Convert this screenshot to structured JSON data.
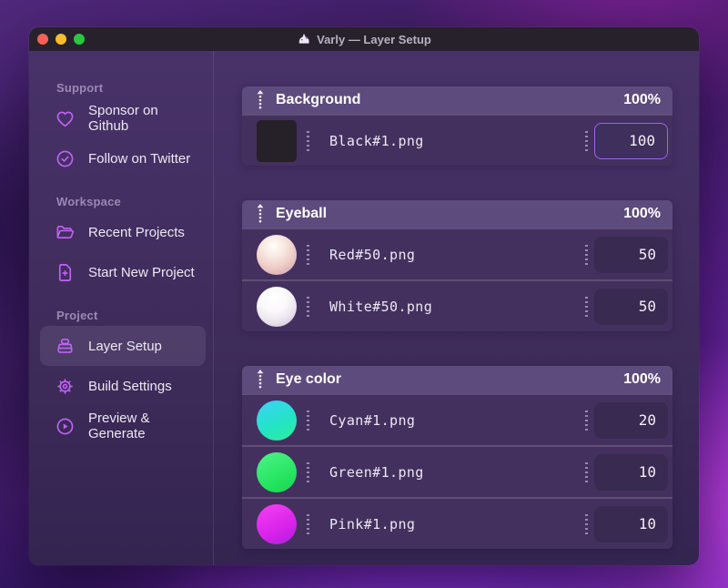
{
  "window": {
    "title": "Varly — Layer Setup"
  },
  "sidebar": {
    "sections": [
      {
        "label": "Support",
        "items": [
          {
            "icon": "heart-icon",
            "label": "Sponsor on Github"
          },
          {
            "icon": "check-badge-icon",
            "label": "Follow on Twitter"
          }
        ]
      },
      {
        "label": "Workspace",
        "items": [
          {
            "icon": "folder-icon",
            "label": "Recent Projects"
          },
          {
            "icon": "file-plus-icon",
            "label": "Start New Project"
          }
        ]
      },
      {
        "label": "Project",
        "items": [
          {
            "icon": "archive-box-icon",
            "label": "Layer Setup",
            "selected": true
          },
          {
            "icon": "gear-icon",
            "label": "Build Settings"
          },
          {
            "icon": "play-circle-icon",
            "label": "Preview & Generate"
          }
        ]
      }
    ]
  },
  "main": {
    "groups": [
      {
        "name": "Background",
        "weight": "100%",
        "layers": [
          {
            "file": "Black#1.png",
            "value": "100",
            "swatch": "black-square",
            "focused": true
          }
        ]
      },
      {
        "name": "Eyeball",
        "weight": "100%",
        "layers": [
          {
            "file": "Red#50.png",
            "value": "50",
            "swatch": "pearl-red"
          },
          {
            "file": "White#50.png",
            "value": "50",
            "swatch": "pearl-white"
          }
        ]
      },
      {
        "name": "Eye color",
        "weight": "100%",
        "layers": [
          {
            "file": "Cyan#1.png",
            "value": "20",
            "swatch": "cyan"
          },
          {
            "file": "Green#1.png",
            "value": "10",
            "swatch": "green"
          },
          {
            "file": "Pink#1.png",
            "value": "10",
            "swatch": "pink"
          }
        ]
      }
    ]
  },
  "colors": {
    "accent": "#bf5af2",
    "input_focus_border": "#a55ef2",
    "traffic_red": "#ff5f57",
    "traffic_yellow": "#febc2e",
    "traffic_green": "#28c840"
  }
}
